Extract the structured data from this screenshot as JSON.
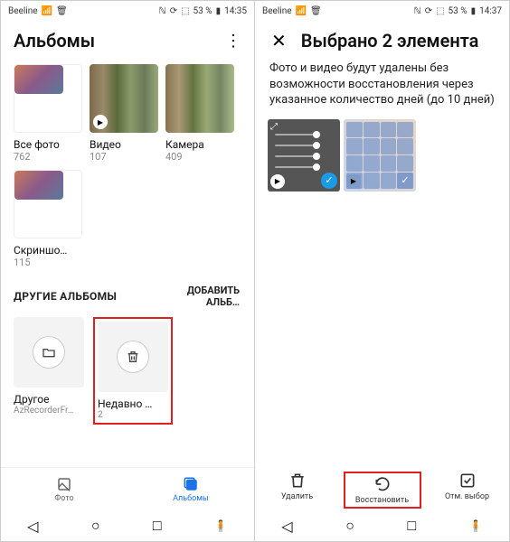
{
  "left": {
    "statusbar": {
      "carrier": "Beeline",
      "battery": "53 %",
      "time": "14:35"
    },
    "header": {
      "title": "Альбомы"
    },
    "albums": [
      {
        "name": "Все фото",
        "count": "762"
      },
      {
        "name": "Видео",
        "count": "107"
      },
      {
        "name": "Камера",
        "count": "409"
      },
      {
        "name": "Скриншо…",
        "count": "115"
      }
    ],
    "section": {
      "label": "ДРУГИЕ АЛЬБОМЫ",
      "add": "ДОБАВИТЬ АЛЬБ…"
    },
    "other": [
      {
        "name": "Другое",
        "sub": "AzRecorderFr…"
      },
      {
        "name": "Недавно …",
        "sub": "2"
      }
    ],
    "tabs": {
      "photo": "Фото",
      "albums": "Альбомы"
    }
  },
  "right": {
    "statusbar": {
      "carrier": "Beeline",
      "battery": "53 %",
      "time": "14:37"
    },
    "header": {
      "title": "Выбрано 2 элемента"
    },
    "warning": "Фото и видео будут удалены без возможности восстановления через указанное количество дней (до 10 дней)",
    "actions": {
      "delete": "Удалить",
      "restore": "Восстановить",
      "cancel": "Отм. выбор"
    }
  }
}
